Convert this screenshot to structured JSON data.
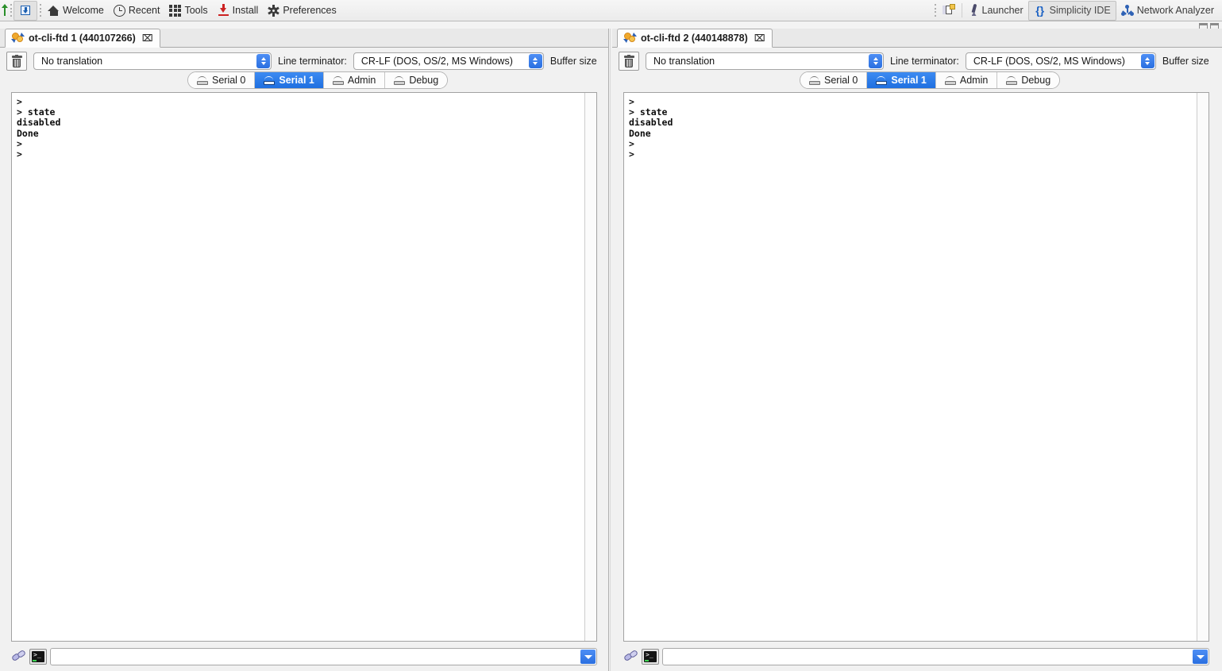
{
  "app_toolbar": {
    "left_items": [
      {
        "label": "",
        "icon": "green-up-arrow-icon",
        "type": "icon"
      },
      {
        "label": "",
        "icon": "flash-chip-icon",
        "type": "icon-pressed"
      },
      {
        "label": "Welcome",
        "icon": "home-icon",
        "type": "text"
      },
      {
        "label": "Recent",
        "icon": "clock-icon",
        "type": "text"
      },
      {
        "label": "Tools",
        "icon": "grid-icon",
        "type": "text"
      },
      {
        "label": "Install",
        "icon": "download-icon",
        "type": "text"
      },
      {
        "label": "Preferences",
        "icon": "gear-icon",
        "type": "text"
      }
    ],
    "right_items": [
      {
        "label": "",
        "icon": "new-perspective-icon",
        "type": "icon"
      },
      {
        "label": "Launcher",
        "icon": "rocket-icon",
        "selected": false
      },
      {
        "label": "Simplicity IDE",
        "icon": "braces-icon",
        "selected": true
      },
      {
        "label": "Network Analyzer",
        "icon": "network-nodes-icon",
        "selected": false
      }
    ],
    "window_controls": [
      "minimize",
      "maximize"
    ]
  },
  "colors": {
    "accent_blue": "#2a6fe0",
    "tab_active_blue": "#1f6fe0",
    "toolbar_bg": "#ebebeb",
    "panel_bg": "#f1f1f1",
    "console_bg": "#ffffff"
  },
  "panels": [
    {
      "id": "left",
      "view_tab": {
        "title": "ot-cli-ftd 1 (440107266)",
        "icon": "device-gears-icon",
        "close_glyph": "⌧"
      },
      "options": {
        "clear_icon": "trash-icon",
        "translation_value": "No translation",
        "terminator_label": "Line terminator:",
        "terminator_value": "CR-LF  (DOS, OS/2, MS Windows)",
        "buffer_label": "Buffer size"
      },
      "serial_tabs": [
        {
          "label": "Serial 0",
          "icon": "serial-port-icon",
          "active": false
        },
        {
          "label": "Serial 1",
          "icon": "serial-port-icon",
          "active": true
        },
        {
          "label": "Admin",
          "icon": "serial-port-icon",
          "active": false
        },
        {
          "label": "Debug",
          "icon": "serial-port-icon",
          "active": false
        }
      ],
      "console_text": ">\n> state\ndisabled\nDone\n>\n>",
      "command_bar": {
        "plug_icon": "plug-connector-icon",
        "terminal_icon": "terminal-icon",
        "input_value": "",
        "input_placeholder": "",
        "dropdown_icon": "chevron-down-icon"
      }
    },
    {
      "id": "right",
      "view_tab": {
        "title": "ot-cli-ftd 2 (440148878)",
        "icon": "device-gears-icon",
        "close_glyph": "⌧"
      },
      "options": {
        "clear_icon": "trash-icon",
        "translation_value": "No translation",
        "terminator_label": "Line terminator:",
        "terminator_value": "CR-LF  (DOS, OS/2, MS Windows)",
        "buffer_label": "Buffer size"
      },
      "serial_tabs": [
        {
          "label": "Serial 0",
          "icon": "serial-port-icon",
          "active": false
        },
        {
          "label": "Serial 1",
          "icon": "serial-port-icon",
          "active": true
        },
        {
          "label": "Admin",
          "icon": "serial-port-icon",
          "active": false
        },
        {
          "label": "Debug",
          "icon": "serial-port-icon",
          "active": false
        }
      ],
      "console_text": ">\n> state\ndisabled\nDone\n>\n>",
      "command_bar": {
        "plug_icon": "plug-connector-icon",
        "terminal_icon": "terminal-icon",
        "input_value": "",
        "input_placeholder": "",
        "dropdown_icon": "chevron-down-icon"
      }
    }
  ]
}
